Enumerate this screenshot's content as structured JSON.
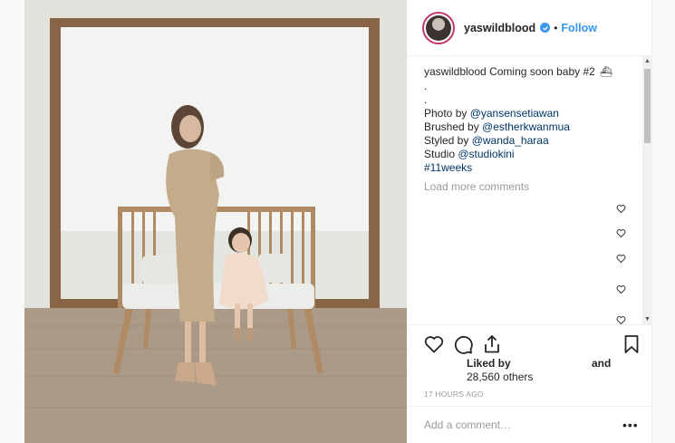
{
  "post": {
    "username": "yaswildblood",
    "follow_separator": "•",
    "follow_label": "Follow",
    "caption": {
      "username": "yaswildblood",
      "text": "Coming soon baby #2",
      "emoji": "⛴",
      "spacer_1": ".",
      "spacer_2": ".",
      "photo_prefix": "Photo by ",
      "photo_handle": "@yansensetiawan",
      "brushed_prefix": "Brushed by ",
      "brushed_handle": "@estherkwanmua",
      "styled_prefix": "Styled by ",
      "styled_handle": "@wanda_haraa",
      "studio_prefix": "Studio ",
      "studio_handle": "@studiokini",
      "hashtag": "#11weeks"
    },
    "load_more": "Load more comments",
    "likes": {
      "prefix": "Liked by",
      "count": "28,560 others",
      "and": "and"
    },
    "timestamp": "17 HOURS AGO",
    "add_comment_placeholder": "Add a comment…",
    "more_options": "•••"
  },
  "icons": {
    "verified": "verified-badge-icon",
    "like": "heart-icon",
    "comment": "comment-bubble-icon",
    "share": "share-icon",
    "save": "bookmark-icon",
    "comment_like": "heart-icon"
  },
  "colors": {
    "link_blue": "#3897f0",
    "mention": "#003569",
    "muted": "#999999",
    "text": "#262626",
    "story_ring": "#c7356d"
  }
}
